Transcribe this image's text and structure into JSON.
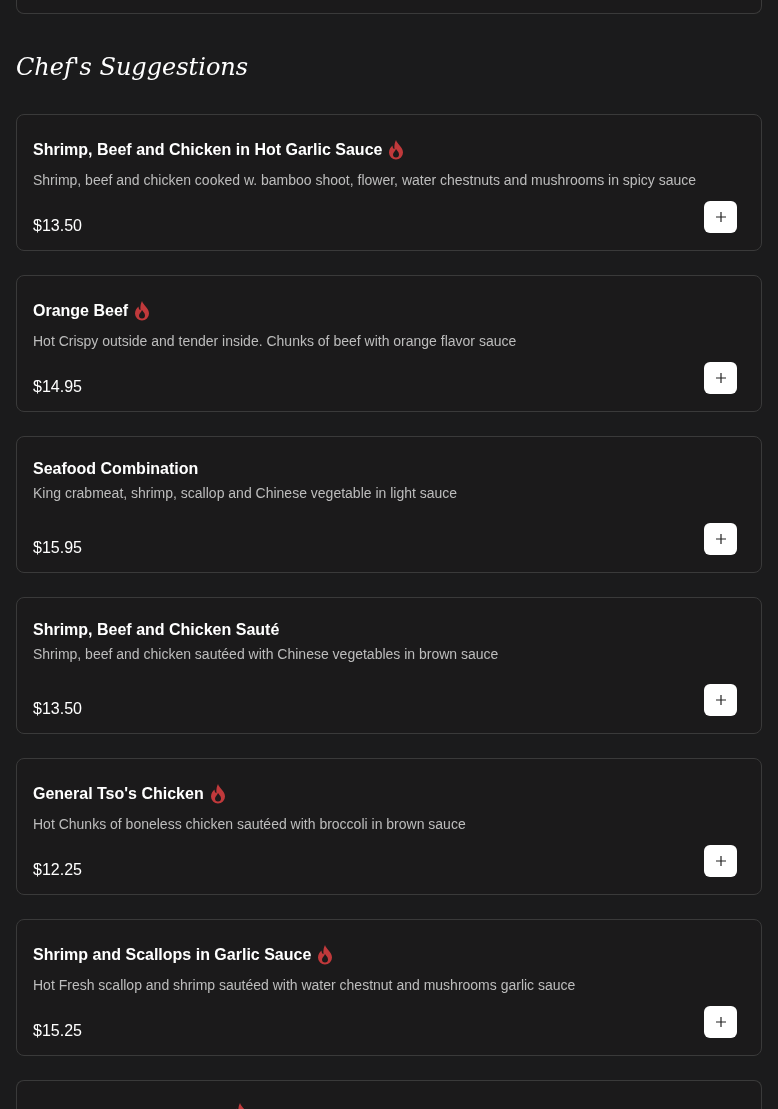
{
  "section_title": "Chef's Suggestions",
  "items": [
    {
      "name": "Shrimp, Beef and Chicken in Hot Garlic Sauce",
      "spicy": true,
      "description": "Shrimp, beef and chicken cooked w. bamboo shoot, flower, water chestnuts and mushrooms in spicy sauce",
      "price": "$13.50"
    },
    {
      "name": "Orange Beef",
      "spicy": true,
      "description": "Hot Crispy outside and tender inside. Chunks of beef with orange flavor sauce",
      "price": "$14.95"
    },
    {
      "name": "Seafood Combination",
      "spicy": false,
      "description": "King crabmeat, shrimp, scallop and Chinese vegetable in light sauce",
      "price": "$15.95"
    },
    {
      "name": "Shrimp, Beef and Chicken Sauté",
      "spicy": false,
      "description": "Shrimp, beef and chicken sautéed with Chinese vegetables in brown sauce",
      "price": "$13.50"
    },
    {
      "name": "General Tso's Chicken",
      "spicy": true,
      "description": "Hot Chunks of boneless chicken sautéed with broccoli in brown sauce",
      "price": "$12.25"
    },
    {
      "name": "Shrimp and Scallops in Garlic Sauce",
      "spicy": true,
      "description": "Hot Fresh scallop and shrimp sautéed with water chestnut and mushrooms garlic sauce",
      "price": "$15.25"
    }
  ],
  "cut_item": {
    "spicy": true
  }
}
